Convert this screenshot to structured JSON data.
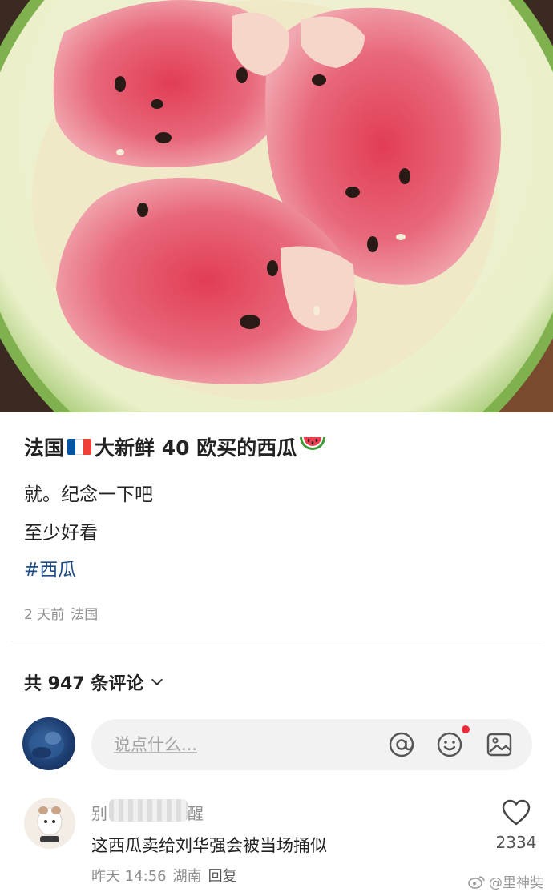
{
  "post": {
    "title_pre": "法国",
    "title_post": "大新鲜 40 欧买的西瓜",
    "line1": "就。纪念一下吧",
    "line2": "至少好看",
    "hashtag": "#西瓜",
    "time": "2 天前",
    "location": "法国"
  },
  "comments": {
    "count_label": "共 947 条评论",
    "input_placeholder": "说点什么..."
  },
  "comment": {
    "name_start": "别",
    "name_end": "醒",
    "text": "这西瓜卖给刘华强会被当场捅似",
    "time": "昨天 14:56",
    "location": "湖南",
    "reply": "回复",
    "likes": "2334"
  },
  "watermark": "@里神奘",
  "colors": {
    "hashtag": "#1f4e86",
    "notify_dot": "#ee2b3a",
    "flag": [
      "#0055A4",
      "#FFFFFF",
      "#EF4135"
    ]
  },
  "icons": [
    "at-icon",
    "emoji-icon",
    "image-icon",
    "heart-icon",
    "chevron-down-icon",
    "weibo-icon"
  ]
}
